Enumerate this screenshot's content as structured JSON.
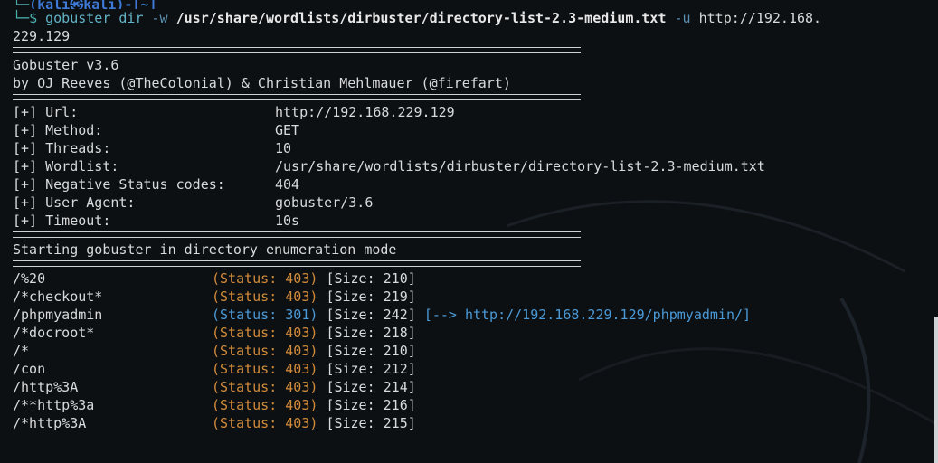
{
  "prompt": {
    "top": "(kali㉿kali)-[~]",
    "symbol": "$"
  },
  "command": {
    "name": "gobuster",
    "args1": "dir",
    "flag_w": "-w",
    "wordlist_arg": "/usr/share/wordlists/dirbuster/directory-list-2.3-medium.txt",
    "flag_u": "-u",
    "url_part1": "http://192.168.",
    "url_part2": "229.129"
  },
  "banner": {
    "title": "Gobuster v3.6",
    "authors": "by OJ Reeves (@TheColonial) & Christian Mehlmauer (@firefart)"
  },
  "options": [
    {
      "key": "[+] Url:",
      "value": "http://192.168.229.129"
    },
    {
      "key": "[+] Method:",
      "value": "GET"
    },
    {
      "key": "[+] Threads:",
      "value": "10"
    },
    {
      "key": "[+] Wordlist:",
      "value": "/usr/share/wordlists/dirbuster/directory-list-2.3-medium.txt"
    },
    {
      "key": "[+] Negative Status codes:",
      "value": "404"
    },
    {
      "key": "[+] User Agent:",
      "value": "gobuster/3.6"
    },
    {
      "key": "[+] Timeout:",
      "value": "10s"
    }
  ],
  "starting": "Starting gobuster in directory enumeration mode",
  "results": [
    {
      "path": "/%20",
      "status": "(Status: 403)",
      "size": "[Size: 210]",
      "redirect": ""
    },
    {
      "path": "/*checkout*",
      "status": "(Status: 403)",
      "size": "[Size: 219]",
      "redirect": ""
    },
    {
      "path": "/phpmyadmin",
      "status": "(Status: 301)",
      "size": "[Size: 242]",
      "redirect": "[--> http://192.168.229.129/phpmyadmin/]"
    },
    {
      "path": "/*docroot*",
      "status": "(Status: 403)",
      "size": "[Size: 218]",
      "redirect": ""
    },
    {
      "path": "/*",
      "status": "(Status: 403)",
      "size": "[Size: 210]",
      "redirect": ""
    },
    {
      "path": "/con",
      "status": "(Status: 403)",
      "size": "[Size: 212]",
      "redirect": ""
    },
    {
      "path": "/http%3A",
      "status": "(Status: 403)",
      "size": "[Size: 214]",
      "redirect": ""
    },
    {
      "path": "/**http%3a",
      "status": "(Status: 403)",
      "size": "[Size: 216]",
      "redirect": ""
    },
    {
      "path": "/*http%3A",
      "status": "(Status: 403)",
      "size": "[Size: 215]",
      "redirect": ""
    }
  ],
  "colors": {
    "background": "#0d1013",
    "status_403": "#d28b3a",
    "status_301": "#4a9ad8",
    "prompt": "#4ab3b0"
  }
}
